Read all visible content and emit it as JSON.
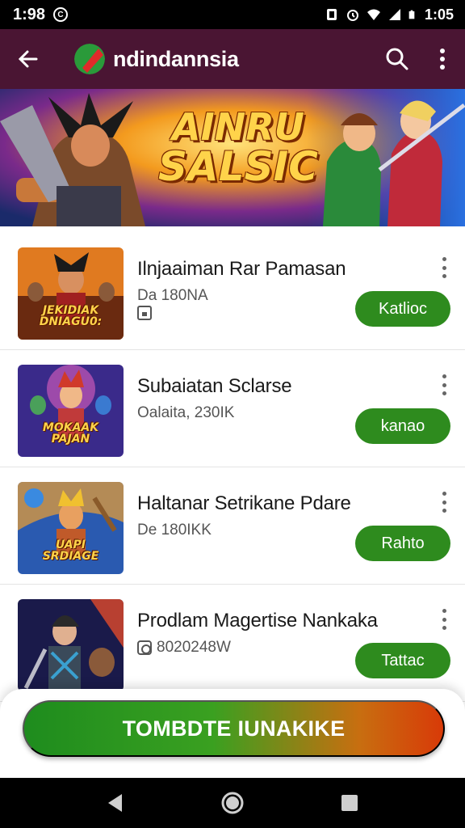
{
  "status_bar": {
    "time": "1:98",
    "clock_right": "1:05",
    "icons": [
      "circle-c-icon",
      "alarm-icon",
      "wifi-icon",
      "signal-icon",
      "battery-icon"
    ]
  },
  "app_bar": {
    "title": "ndindannsia",
    "icons": [
      "back-arrow-icon",
      "logo-icon",
      "search-icon",
      "more-vert-icon"
    ],
    "color": "#4a1533"
  },
  "banner": {
    "line1": "AINRU",
    "line2": "SALSIC"
  },
  "items": [
    {
      "title": "Ilnjaaiman Rar Pamasan",
      "subtitle": "Da 180NA",
      "button": "Katlioc",
      "thumb_label": "JEKIDIAK\nDNIAGU0:"
    },
    {
      "title": "Subaiatan Sclarse",
      "subtitle": "Oalaita, 230IK",
      "button": "kanao",
      "thumb_label": "MOKAAK\nPAJAN"
    },
    {
      "title": "Haltanar Setrikane Pdare",
      "subtitle": "De 180IKK",
      "button": "Rahto",
      "thumb_label": "UAPI\nSRDIAGE"
    },
    {
      "title": "Prodlam Magertise Nankaka",
      "subtitle": "8020248W",
      "button": "Tattac",
      "thumb_label": ""
    }
  ],
  "cta": {
    "label": "TOMBDTE IUNAKIKE"
  },
  "colors": {
    "accent_green": "#2e8b1e",
    "appbar": "#4a1533"
  },
  "nav_bar": {
    "icons": [
      "nav-back-icon",
      "nav-home-icon",
      "nav-recents-icon"
    ]
  }
}
